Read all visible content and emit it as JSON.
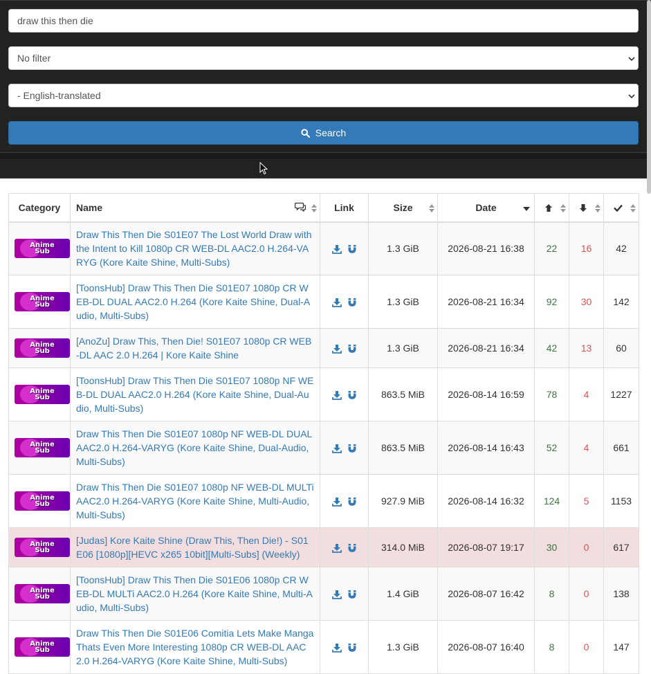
{
  "search": {
    "query": "draw this then die",
    "button_label": "Search"
  },
  "filters": {
    "filter_selected": "No filter",
    "category_selected": "- English-translated"
  },
  "table": {
    "headers": {
      "category": "Category",
      "name": "Name",
      "link": "Link",
      "size": "Size",
      "date": "Date"
    },
    "category_badge": {
      "line1": "Anime",
      "line2": "Sub"
    },
    "rows": [
      {
        "name": "Draw This Then Die S01E07 The Lost World Draw with the Intent to Kill 1080p CR WEB-DL AAC2.0 H.264-VARYG (Kore Kaite Shine, Multi-Subs)",
        "size": "1.3 GiB",
        "date": "2026-08-21 16:38",
        "seeders": "22",
        "leechers": "16",
        "completed": "42"
      },
      {
        "name": "[ToonsHub] Draw This Then Die S01E07 1080p CR WEB-DL DUAL AAC2.0 H.264 (Kore Kaite Shine, Dual-Audio, Multi-Subs)",
        "size": "1.3 GiB",
        "date": "2026-08-21 16:34",
        "seeders": "92",
        "leechers": "30",
        "completed": "142"
      },
      {
        "name": "[AnoZu] Draw This, Then Die! S01E07 1080p CR WEB-DL AAC 2.0 H.264 | Kore Kaite Shine",
        "size": "1.3 GiB",
        "date": "2026-08-21 16:34",
        "seeders": "42",
        "leechers": "13",
        "completed": "60"
      },
      {
        "name": "[ToonsHub] Draw This Then Die S01E07 1080p NF WEB-DL DUAL AAC2.0 H.264 (Kore Kaite Shine, Dual-Audio, Multi-Subs)",
        "size": "863.5 MiB",
        "date": "2026-08-14 16:59",
        "seeders": "78",
        "leechers": "4",
        "completed": "1227"
      },
      {
        "name": "Draw This Then Die S01E07 1080p NF WEB-DL DUAL AAC2.0 H.264-VARYG (Kore Kaite Shine, Dual-Audio, Multi-Subs)",
        "size": "863.5 MiB",
        "date": "2026-08-14 16:43",
        "seeders": "52",
        "leechers": "4",
        "completed": "661"
      },
      {
        "name": "Draw This Then Die S01E07 1080p NF WEB-DL MULTi AAC2.0 H.264-VARYG (Kore Kaite Shine, Multi-Audio, Multi-Subs)",
        "size": "927.9 MiB",
        "date": "2026-08-14 16:32",
        "seeders": "124",
        "leechers": "5",
        "completed": "1153"
      },
      {
        "name": "[Judas] Kore Kaite Shine (Draw This, Then Die!) - S01E06 [1080p][HEVC x265 10bit][Multi-Subs] (Weekly)",
        "size": "314.0 MiB",
        "date": "2026-08-07 19:17",
        "seeders": "30",
        "leechers": "0",
        "completed": "617"
      },
      {
        "name": "[ToonsHub] Draw This Then Die S01E06 1080p CR WEB-DL MULTi AAC2.0 H.264 (Kore Kaite Shine, Multi-Audio, Multi-Subs)",
        "size": "1.4 GiB",
        "date": "2026-08-07 16:42",
        "seeders": "8",
        "leechers": "0",
        "completed": "138"
      },
      {
        "name": "Draw This Then Die S01E06 Comitia Lets Make Manga Thats Even More Interesting 1080p CR WEB-DL AAC2.0 H.264-VARYG (Kore Kaite Shine, Multi-Subs)",
        "size": "1.3 GiB",
        "date": "2026-08-07 16:40",
        "seeders": "8",
        "leechers": "0",
        "completed": "147"
      }
    ]
  },
  "colors": {
    "topbar": "#222222",
    "primary": "#337ab7",
    "link": "#337ab7",
    "seeders": "#3c763d",
    "leechers": "#d9534f",
    "danger_row": "#f2dede"
  }
}
